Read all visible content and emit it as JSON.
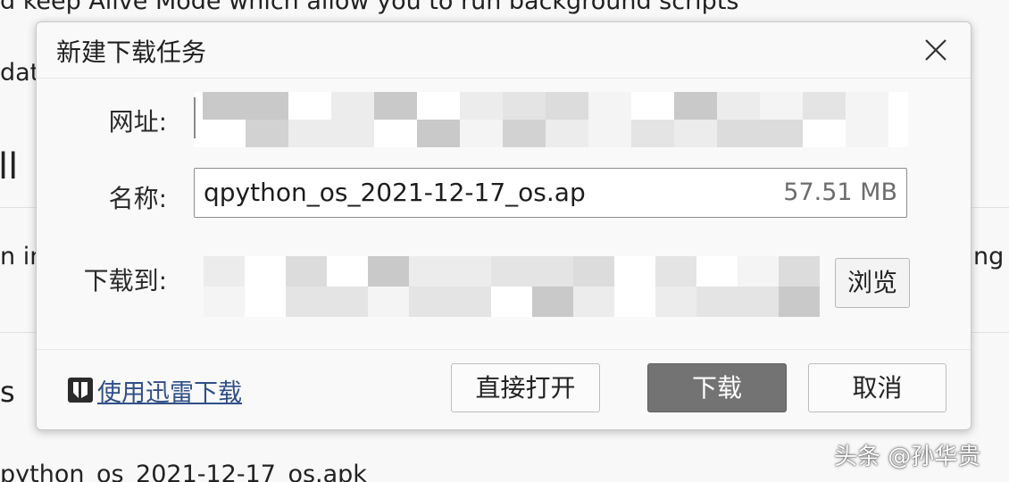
{
  "background": {
    "line1": "d keep Alive Mode which allow you to run background scripts",
    "line2": "dat",
    "line3": "ll",
    "line4": "n in",
    "line4_right": "ng",
    "line5": "s",
    "line6": "python_os_2021-12-17_os.apk"
  },
  "dialog": {
    "title": "新建下载任务",
    "close_icon": "close-icon",
    "url_label": "网址:",
    "name_label": "名称:",
    "name_value": "qpython_os_2021-12-17_os.ap",
    "size_value": "57.51 MB",
    "path_label": "下载到:",
    "browse_label": "浏览",
    "xunlei_label": "使用迅雷下载",
    "xunlei_icon": "xunlei-icon",
    "open_label": "直接打开",
    "download_label": "下载",
    "cancel_label": "取消"
  },
  "watermark": "头条 @孙华贵",
  "colors": {
    "primary_button": "#737373",
    "link": "#2f4f88"
  }
}
